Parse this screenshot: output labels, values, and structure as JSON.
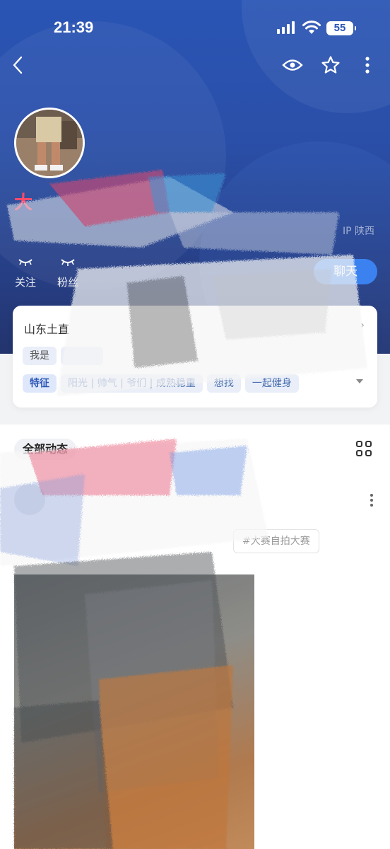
{
  "status_bar": {
    "time": "21:39",
    "battery": "55"
  },
  "profile": {
    "name": "大",
    "ip": "IP 陕西",
    "stats": [
      {
        "label": "关注"
      },
      {
        "label": "粉丝"
      }
    ],
    "chat_label": "聊天"
  },
  "info_card": {
    "title": "山东土直",
    "tags_row1": [
      "我是"
    ],
    "tags_row2": [
      {
        "key": "特征",
        "text": "阳光 | 帅气 | 爷们 | 成熟稳重"
      },
      {
        "text": "想找"
      },
      {
        "text": "一起健身"
      }
    ]
  },
  "feed": {
    "tab_label": "全部动态",
    "topic": "#大赛自拍大赛"
  },
  "icons": {
    "back": "back-arrow-icon",
    "eye": "eye-icon",
    "star": "star-icon",
    "more": "more-vertical-icon",
    "grid": "grid-view-icon"
  },
  "colors": {
    "header": "#2a55b5",
    "chat_button": "#3b82f0",
    "username": "#ff4a6a"
  }
}
